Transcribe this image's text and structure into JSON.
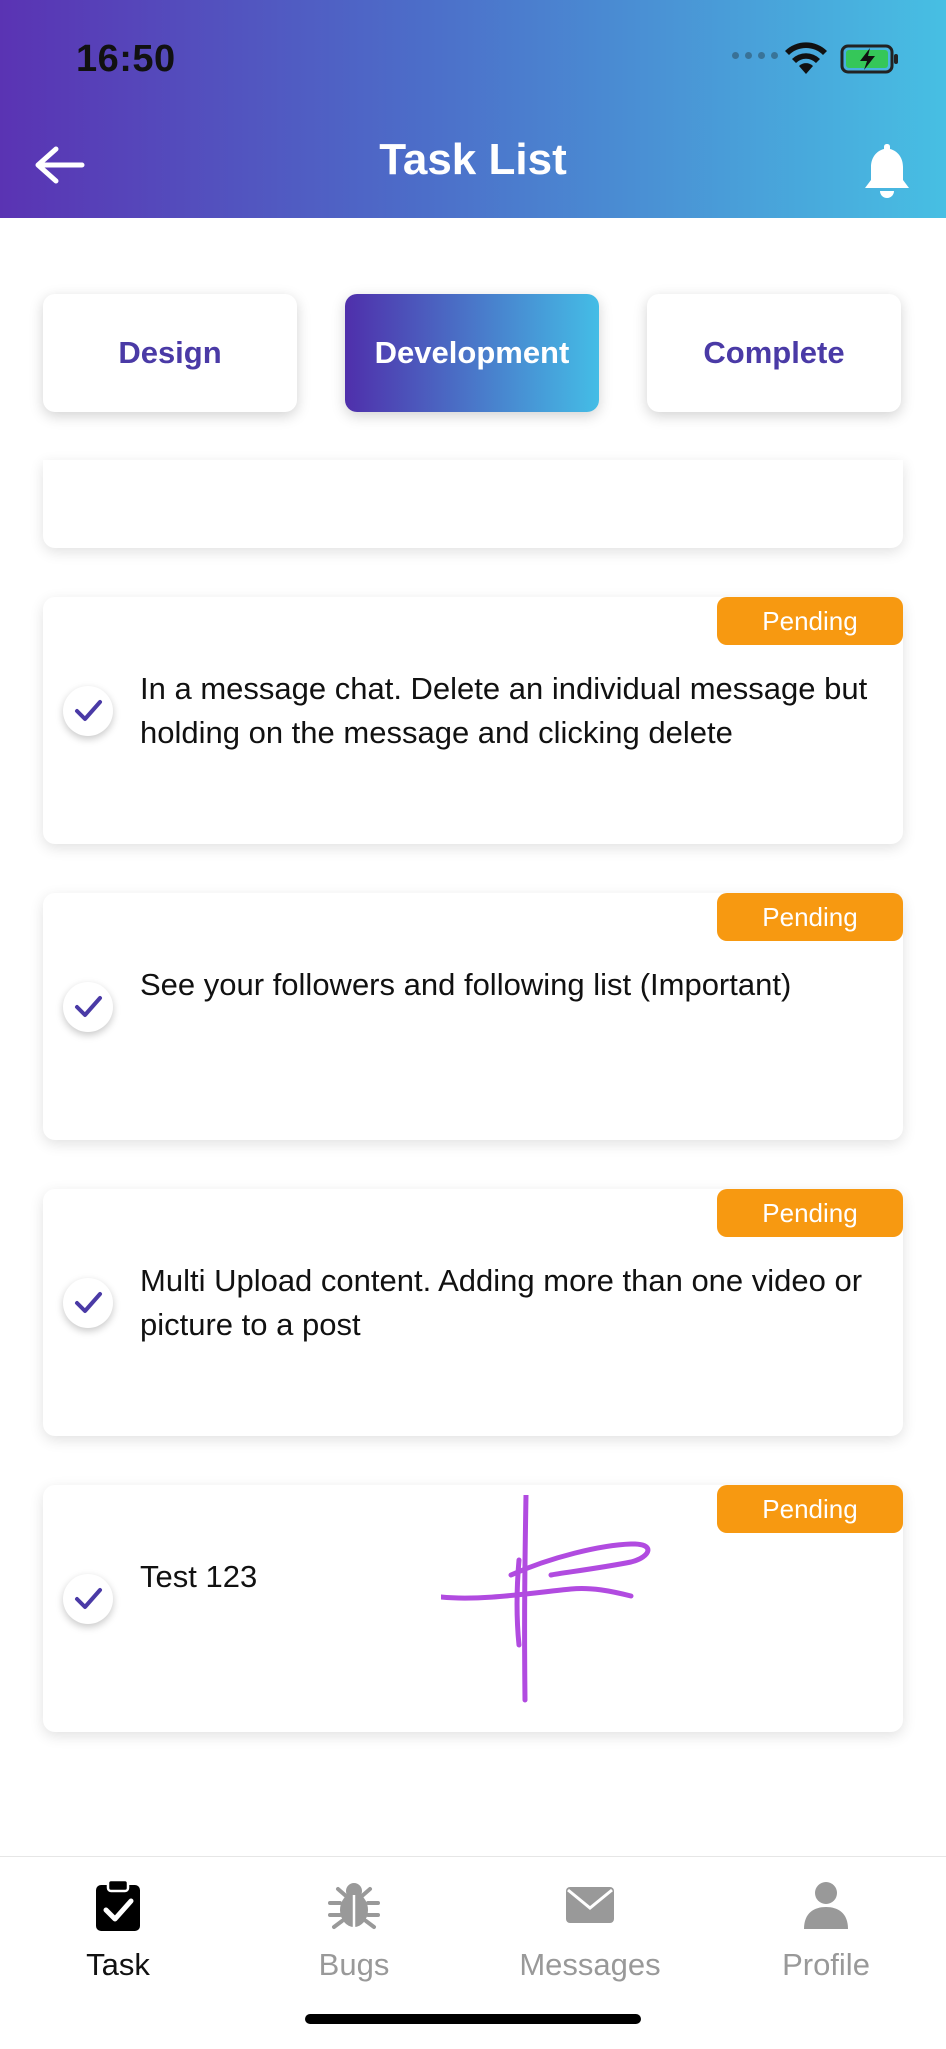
{
  "status_bar": {
    "time": "16:50"
  },
  "header": {
    "title": "Task List"
  },
  "tabs": [
    {
      "label": "Design",
      "active": false
    },
    {
      "label": "Development",
      "active": true
    },
    {
      "label": "Complete",
      "active": false
    }
  ],
  "tasks": [
    {
      "text": "In a message chat. Delete an individual message but holding on the message and clicking delete",
      "status": "Pending"
    },
    {
      "text": "See your followers and following list (Important)",
      "status": "Pending"
    },
    {
      "text": "Multi Upload content. Adding more than one video or picture to a post",
      "status": "Pending"
    },
    {
      "text": "Test 123",
      "status": "Pending"
    }
  ],
  "bottom_nav": [
    {
      "label": "Task",
      "icon": "clipboard-check-icon",
      "active": true
    },
    {
      "label": "Bugs",
      "icon": "bug-icon",
      "active": false
    },
    {
      "label": "Messages",
      "icon": "envelope-icon",
      "active": false
    },
    {
      "label": "Profile",
      "icon": "person-icon",
      "active": false
    }
  ],
  "colors": {
    "header_gradient_start": "#5a33b3",
    "header_gradient_end": "#47bfe3",
    "accent_purple": "#4a3aa6",
    "pending_badge": "#f79911",
    "signature_stroke": "#b14be0"
  }
}
